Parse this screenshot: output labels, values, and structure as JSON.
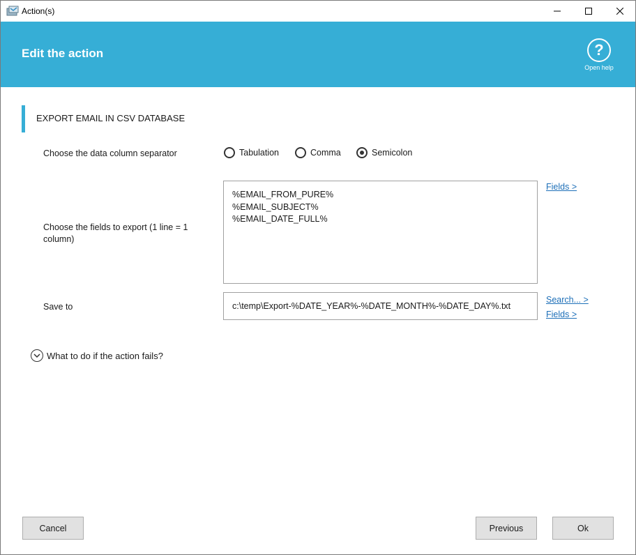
{
  "window": {
    "title": "Action(s)"
  },
  "header": {
    "title": "Edit the action",
    "help_label": "Open help",
    "color": "#36aed6"
  },
  "section": {
    "title": "EXPORT EMAIL IN CSV DATABASE"
  },
  "separator": {
    "label": "Choose the data column separator",
    "options": [
      "Tabulation",
      "Comma",
      "Semicolon"
    ],
    "selected": "Semicolon"
  },
  "fields": {
    "label": "Choose the fields to export (1 line = 1 column)",
    "lines": [
      "%EMAIL_FROM_PURE%",
      "%EMAIL_SUBJECT%",
      "%EMAIL_DATE_FULL%"
    ],
    "fields_link": "Fields >"
  },
  "save_to": {
    "label": "Save to",
    "value": "c:\\temp\\Export-%DATE_YEAR%-%DATE_MONTH%-%DATE_DAY%.txt",
    "search_link": "Search... >",
    "fields_link": "Fields >"
  },
  "failure": {
    "label": "What to do if the action fails?"
  },
  "buttons": {
    "cancel": "Cancel",
    "previous": "Previous",
    "ok": "Ok"
  }
}
